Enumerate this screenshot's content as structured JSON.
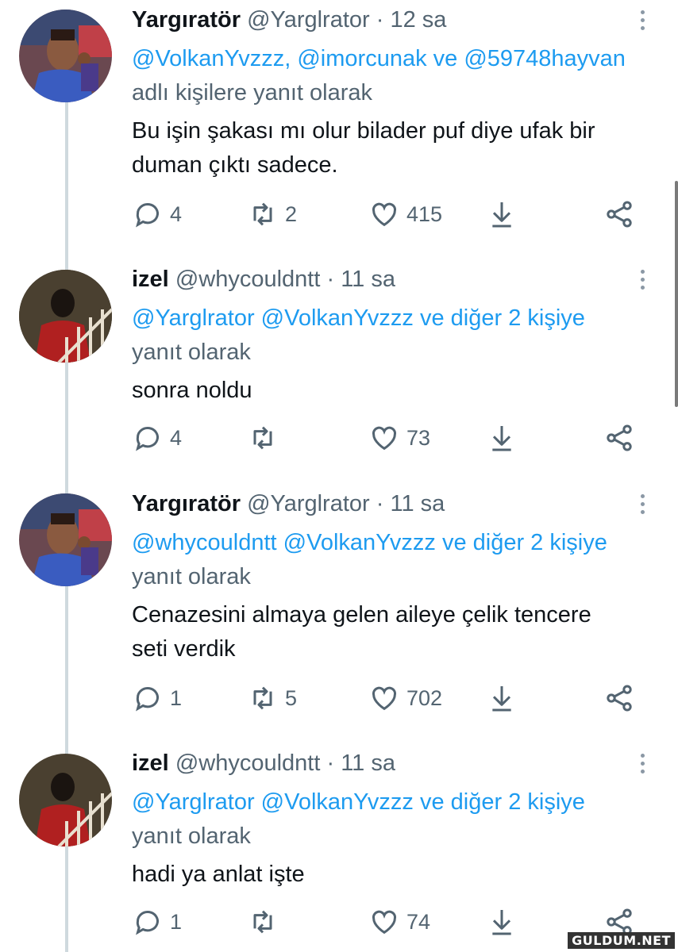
{
  "tweets": [
    {
      "name": "Yargıratör",
      "handle": "@Yarglrator",
      "sep": "·",
      "time": "12 sa",
      "reply_mentions": "@VolkanYvzzz, @imorcunak ve @59748hayvan",
      "reply_suffix": "adlı kişilere yanıt olarak",
      "text_line1": "Bu işin şakası mı olur bilader puf diye ufak bir",
      "text_line2": "duman çıktı sadece.",
      "replies": "4",
      "retweets": "2",
      "likes": "415",
      "avatar_icon": "user-avatar-yargirator"
    },
    {
      "name": "izel",
      "handle": "@whycouldntt",
      "sep": "·",
      "time": "11 sa",
      "reply_mentions": "@Yarglrator @VolkanYvzzz ve diğer 2 kişiye",
      "reply_suffix": "yanıt olarak",
      "text_line1": "sonra noldu",
      "text_line2": "",
      "replies": "4",
      "retweets": "",
      "likes": "73",
      "avatar_icon": "user-avatar-izel"
    },
    {
      "name": "Yargıratör",
      "handle": "@Yarglrator",
      "sep": "·",
      "time": "11 sa",
      "reply_mentions": "@whycouldntt @VolkanYvzzz ve diğer 2 kişiye",
      "reply_suffix": "yanıt olarak",
      "text_line1": "Cenazesini almaya gelen aileye çelik tencere",
      "text_line2": "seti verdik",
      "replies": "1",
      "retweets": "5",
      "likes": "702",
      "avatar_icon": "user-avatar-yargirator"
    },
    {
      "name": "izel",
      "handle": "@whycouldntt",
      "sep": "·",
      "time": "11 sa",
      "reply_mentions": "@Yarglrator @VolkanYvzzz ve diğer 2 kişiye",
      "reply_suffix": "yanıt olarak",
      "text_line1": "hadi ya anlat işte",
      "text_line2": "",
      "replies": "1",
      "retweets": "",
      "likes": "74",
      "avatar_icon": "user-avatar-izel"
    }
  ],
  "icons": {
    "reply": "reply-icon",
    "retweet": "retweet-icon",
    "like": "heart-icon",
    "download": "download-icon",
    "share": "share-icon",
    "more": "more-vertical-icon"
  },
  "colors": {
    "mention": "#1d9bf0",
    "secondary_text": "#536471",
    "primary_text": "#0f1419",
    "thread_line": "#cfd9de"
  },
  "watermark": "GULDUM.NET"
}
